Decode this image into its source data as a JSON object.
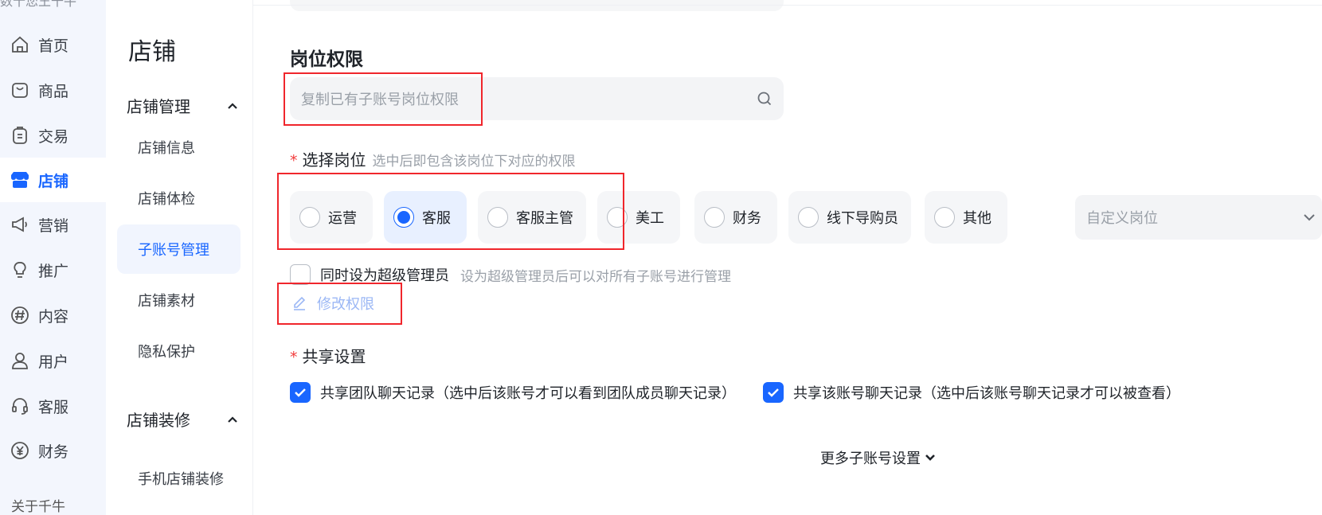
{
  "rail": {
    "top_text": "数十您王千牛",
    "items": [
      {
        "label": "首页",
        "icon": "home-icon"
      },
      {
        "label": "商品",
        "icon": "bag-icon"
      },
      {
        "label": "交易",
        "icon": "clipboard-icon"
      },
      {
        "label": "店铺",
        "icon": "store-icon"
      },
      {
        "label": "营销",
        "icon": "megaphone-icon"
      },
      {
        "label": "推广",
        "icon": "bulb-icon"
      },
      {
        "label": "内容",
        "icon": "hashtag-icon"
      },
      {
        "label": "用户",
        "icon": "user-icon"
      },
      {
        "label": "客服",
        "icon": "headset-icon"
      },
      {
        "label": "财务",
        "icon": "yen-icon"
      }
    ],
    "bottom_text": "关于千牛"
  },
  "subnav": {
    "title": "店铺",
    "groups": [
      {
        "label": "店铺管理",
        "items": [
          "店铺信息",
          "店铺体检",
          "子账号管理",
          "店铺素材",
          "隐私保护"
        ]
      },
      {
        "label": "店铺装修",
        "items": [
          "手机店铺装修"
        ]
      }
    ]
  },
  "main": {
    "section_title": "岗位权限",
    "search_placeholder": "复制已有子账号岗位权限",
    "select_role": {
      "required_mark": "*",
      "label": "选择岗位",
      "hint": "选中后即包含该岗位下对应的权限",
      "roles": [
        "运营",
        "客服",
        "客服主管",
        "美工",
        "财务",
        "线下导购员",
        "其他"
      ],
      "selected": "客服",
      "custom_placeholder": "自定义岗位"
    },
    "admin": {
      "label": "同时设为超级管理员",
      "hint": "设为超级管理员后可以对所有子账号进行管理"
    },
    "edit_link": "修改权限",
    "share": {
      "required_mark": "*",
      "title": "共享设置",
      "options": [
        "共享团队聊天记录（选中后该账号才可以看到团队成员聊天记录）",
        "共享该账号聊天记录（选中后该账号聊天记录才可以被查看）"
      ]
    },
    "more_settings": "更多子账号设置"
  },
  "colors": {
    "accent": "#1966ff",
    "required": "#f23c3c",
    "annotation": "#f0262c"
  }
}
